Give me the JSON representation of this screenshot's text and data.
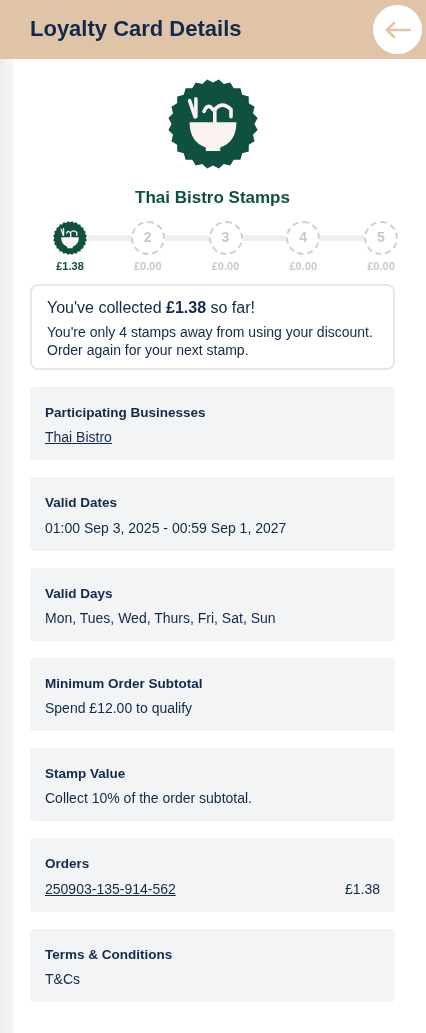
{
  "header": {
    "title": "Loyalty Card Details"
  },
  "card": {
    "name": "Thai Bistro Stamps"
  },
  "stamps": [
    {
      "collected": true,
      "amount": "£1.38"
    },
    {
      "collected": false,
      "label": "2",
      "amount": "£0.00"
    },
    {
      "collected": false,
      "label": "3",
      "amount": "£0.00"
    },
    {
      "collected": false,
      "label": "4",
      "amount": "£0.00"
    },
    {
      "collected": false,
      "label": "5",
      "amount": "£0.00"
    }
  ],
  "message": {
    "headline": "You've collected **£1.38** so far!",
    "body": "You're only 4 stamps away from using your discount. Order again for your next stamp."
  },
  "sections": [
    {
      "title": "Participating Businesses",
      "kind": "link",
      "value": "Thai Bistro"
    },
    {
      "title": "Valid Dates",
      "kind": "text",
      "value": "01:00 Sep 3, 2025 - 00:59 Sep 1, 2027"
    },
    {
      "title": "Valid Days",
      "kind": "text",
      "value": "Mon, Tues, Wed, Thurs, Fri, Sat, Sun"
    },
    {
      "title": "Minimum Order Subtotal",
      "kind": "text",
      "value": "Spend £12.00 to qualify"
    },
    {
      "title": "Stamp Value",
      "kind": "text",
      "value": "Collect 10% of the order subtotal."
    },
    {
      "title": "Orders",
      "kind": "link",
      "value": "250903-135-914-562",
      "amount": "£1.38"
    },
    {
      "title": "Terms & Conditions",
      "kind": "text",
      "value": "T&Cs"
    }
  ]
}
